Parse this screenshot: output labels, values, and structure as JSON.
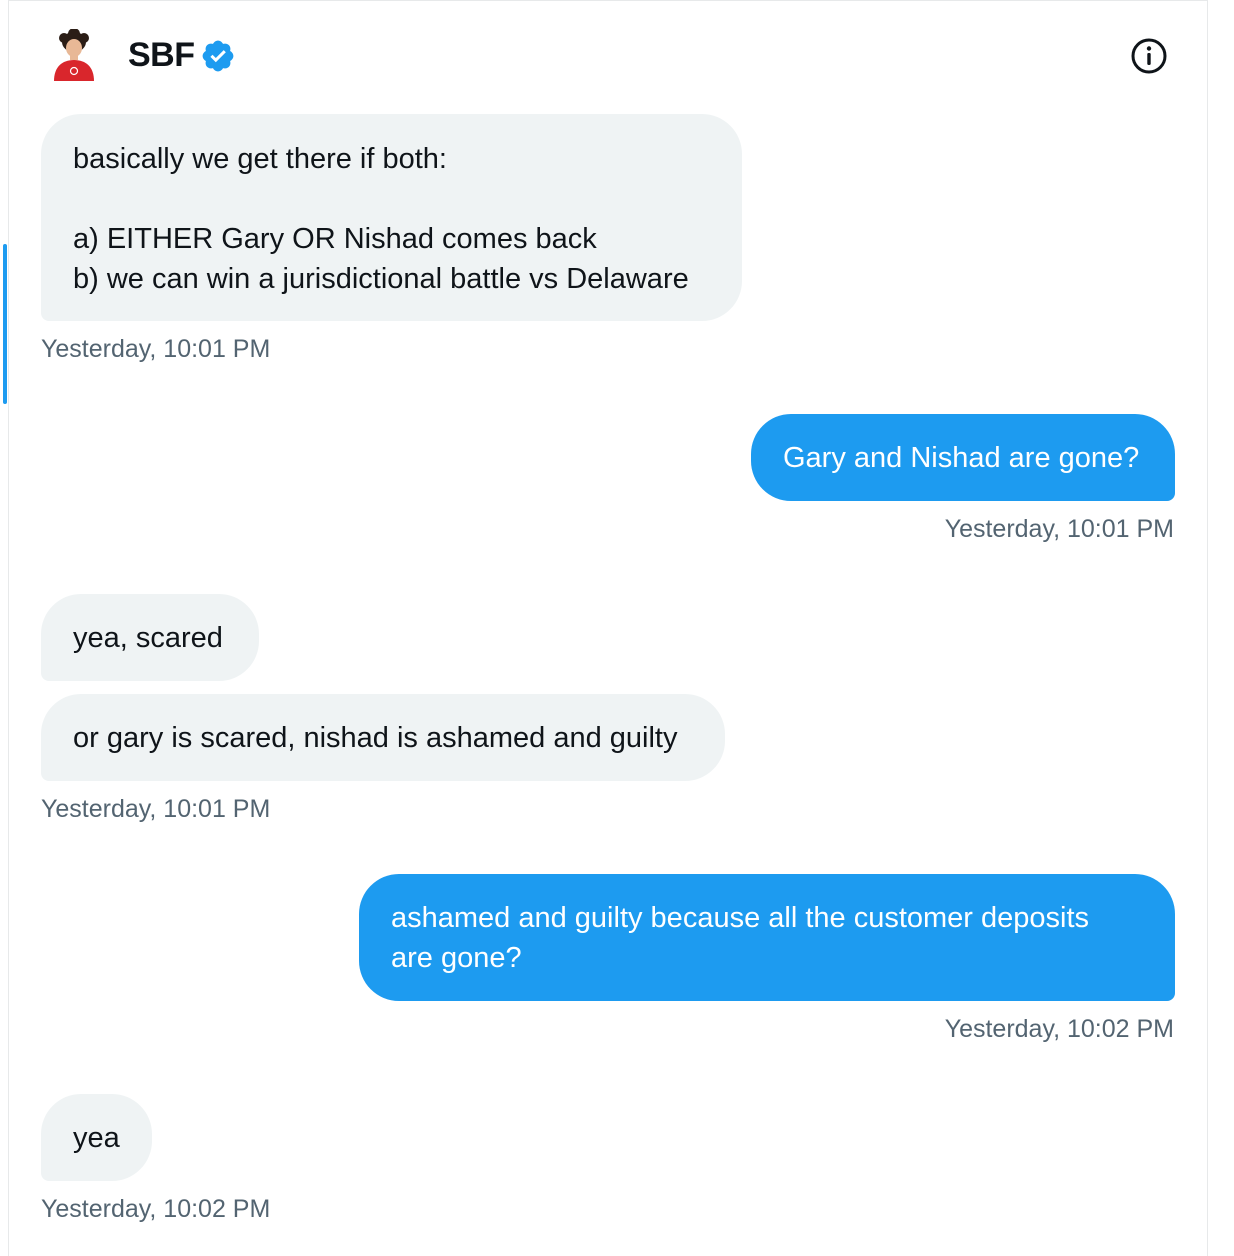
{
  "header": {
    "name": "SBF",
    "verified_icon": "verified-badge-icon",
    "info_icon": "info-icon",
    "accent": "#1d9bf0"
  },
  "messages": [
    {
      "side": "in",
      "lines": [
        "basically we get there if both:",
        "",
        "a) EITHER Gary OR Nishad comes back",
        "b) we can win a jurisdictional battle vs Delaware"
      ],
      "timestamp": "Yesterday, 10:01 PM"
    },
    {
      "side": "out",
      "lines": [
        "Gary and Nishad are gone?"
      ],
      "timestamp": "Yesterday, 10:01 PM"
    },
    {
      "side": "in",
      "lines": [
        "yea, scared"
      ]
    },
    {
      "side": "in",
      "lines": [
        "or gary is scared, nishad is ashamed and guilty"
      ],
      "timestamp": "Yesterday, 10:01 PM"
    },
    {
      "side": "out",
      "lines": [
        "ashamed and guilty because all the customer deposits",
        "are gone?"
      ],
      "timestamp": "Yesterday, 10:02 PM"
    },
    {
      "side": "in",
      "lines": [
        "yea"
      ],
      "timestamp": "Yesterday, 10:02 PM"
    }
  ]
}
